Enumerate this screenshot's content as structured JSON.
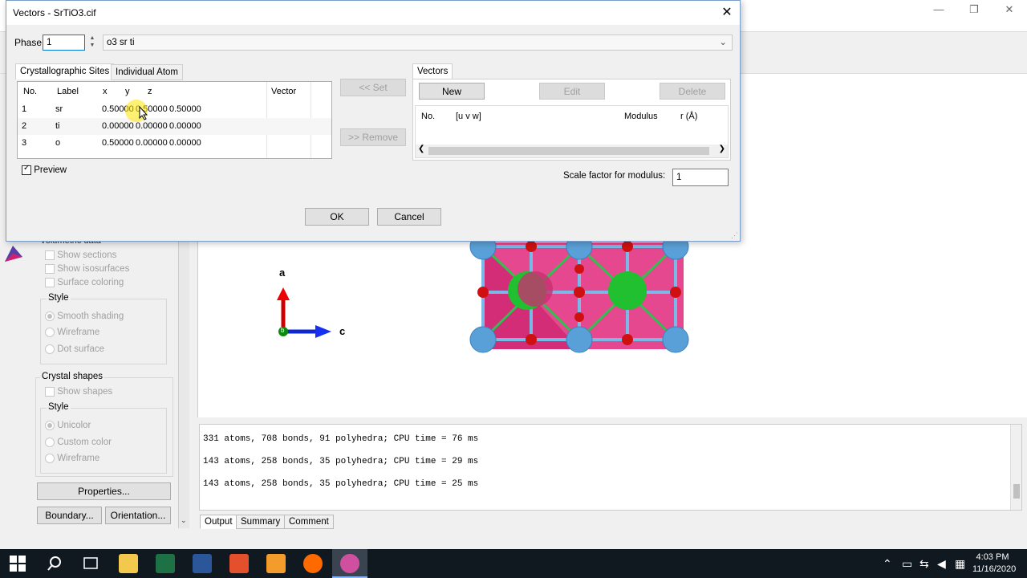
{
  "main_window": {
    "controls": {
      "minimize": "—",
      "restore": "❐",
      "close": "✕"
    },
    "left_panel": {
      "volumetric_title": "Volumetric data",
      "show_sections": "Show sections",
      "show_isosurfaces": "Show isosurfaces",
      "surface_coloring": "Surface coloring",
      "style_label": "Style",
      "smooth_shading": "Smooth shading",
      "wireframe": "Wireframe",
      "dot_surface": "Dot surface",
      "crystal_shapes_title": "Crystal shapes",
      "show_shapes": "Show shapes",
      "style2_label": "Style",
      "unicolor": "Unicolor",
      "custom_color": "Custom color",
      "wireframe2": "Wireframe",
      "properties_button": "Properties...",
      "boundary_button": "Boundary...",
      "orientation_button": "Orientation..."
    },
    "axes": {
      "a": "a",
      "c": "c",
      "b": "b"
    },
    "output_lines": [
      "331 atoms, 708 bonds, 91 polyhedra; CPU time = 76 ms",
      "143 atoms, 258 bonds, 35 polyhedra; CPU time = 29 ms",
      "143 atoms, 258 bonds, 35 polyhedra; CPU time = 25 ms"
    ],
    "output_tabs": [
      "Output",
      "Summary",
      "Comment"
    ]
  },
  "dialog": {
    "title": "Vectors - SrTiO3.cif",
    "close": "✕",
    "phase_label": "Phase:",
    "phase_value": "1",
    "phase_select": "o3 sr ti",
    "tabs": [
      "Crystallographic Sites",
      "Individual Atom"
    ],
    "sites_headers": [
      "No.",
      "Label",
      "x",
      "y",
      "z",
      "Vector"
    ],
    "sites_rows": [
      [
        "1",
        "sr",
        "0.50000",
        "0.50000",
        "0.50000",
        ""
      ],
      [
        "2",
        "ti",
        "0.00000",
        "0.00000",
        "0.00000",
        ""
      ],
      [
        "3",
        "o",
        "0.50000",
        "0.00000",
        "0.00000",
        ""
      ]
    ],
    "set_button": "<< Set",
    "remove_button": ">> Remove",
    "preview_label": "Preview",
    "vectors_tab": "Vectors",
    "new_button": "New",
    "edit_button": "Edit",
    "delete_button": "Delete",
    "vectors_headers": [
      "No.",
      "[u v w]",
      "Modulus",
      "r (Å)"
    ],
    "scale_label": "Scale factor for modulus:",
    "scale_value": "1",
    "ok_button": "OK",
    "cancel_button": "Cancel"
  },
  "taskbar": {
    "time": "4:03 PM",
    "date": "11/16/2020"
  }
}
